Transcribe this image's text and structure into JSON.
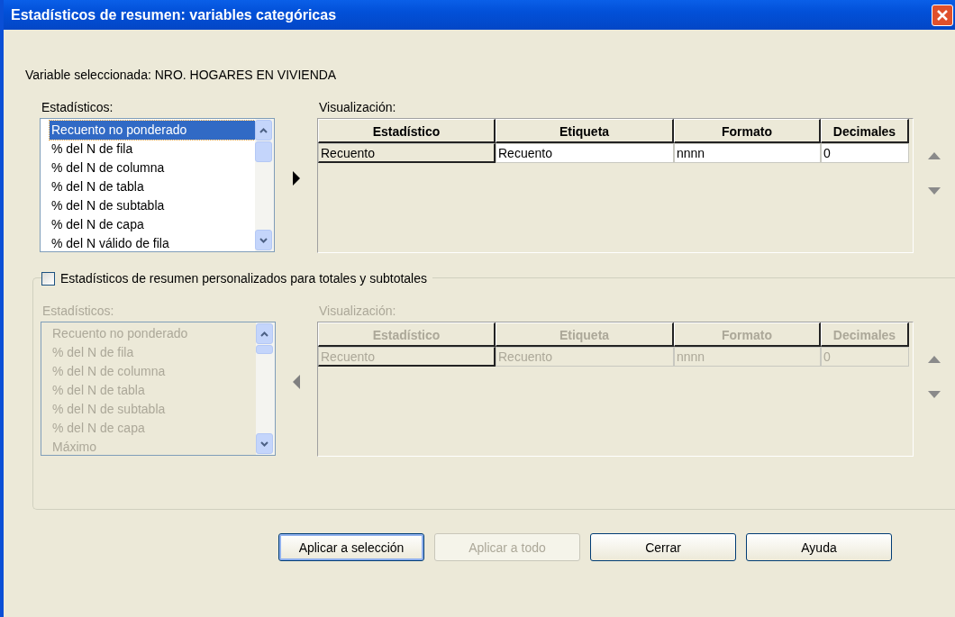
{
  "window": {
    "title": "Estadísticos de resumen: variables categóricas"
  },
  "variable_label": "Variable seleccionada: NRO. HOGARES EN VIVIENDA",
  "main": {
    "stats_label": "Estadísticos:",
    "display_label": "Visualización:",
    "stats": [
      {
        "label": "Recuento no ponderado",
        "selected": true
      },
      {
        "label": "% del N de fila",
        "selected": false
      },
      {
        "label": "% del N de columna",
        "selected": false
      },
      {
        "label": "% del N de tabla",
        "selected": false
      },
      {
        "label": "% del N de subtabla",
        "selected": false
      },
      {
        "label": "% del N de capa",
        "selected": false
      },
      {
        "label": "% del N válido de fila",
        "selected": false
      }
    ],
    "columns": [
      "Estadístico",
      "Etiqueta",
      "Formato",
      "Decimales"
    ],
    "rows": [
      [
        "Recuento",
        "Recuento",
        "nnnn",
        "0"
      ]
    ]
  },
  "custom": {
    "checkbox": {
      "label": "Estadísticos de resumen personalizados para totales y subtotales",
      "checked": false
    },
    "stats_label": "Estadísticos:",
    "display_label": "Visualización:",
    "stats": [
      {
        "label": "Recuento no ponderado",
        "selected": false
      },
      {
        "label": "% del N de fila",
        "selected": false
      },
      {
        "label": "% del N de columna",
        "selected": false
      },
      {
        "label": "% del N de tabla",
        "selected": false
      },
      {
        "label": "% del N de subtabla",
        "selected": false
      },
      {
        "label": "% del N de capa",
        "selected": false
      },
      {
        "label": "Máximo",
        "selected": false
      }
    ],
    "columns": [
      "Estadístico",
      "Etiqueta",
      "Formato",
      "Decimales"
    ],
    "rows": [
      [
        "Recuento",
        "Recuento",
        "nnnn",
        "0"
      ]
    ]
  },
  "buttons": [
    {
      "label": "Aplicar a selección",
      "disabled": false,
      "default": true
    },
    {
      "label": "Aplicar a todo",
      "disabled": true,
      "default": false
    },
    {
      "label": "Cerrar",
      "disabled": false,
      "default": false
    },
    {
      "label": "Ayuda",
      "disabled": false,
      "default": false
    }
  ]
}
